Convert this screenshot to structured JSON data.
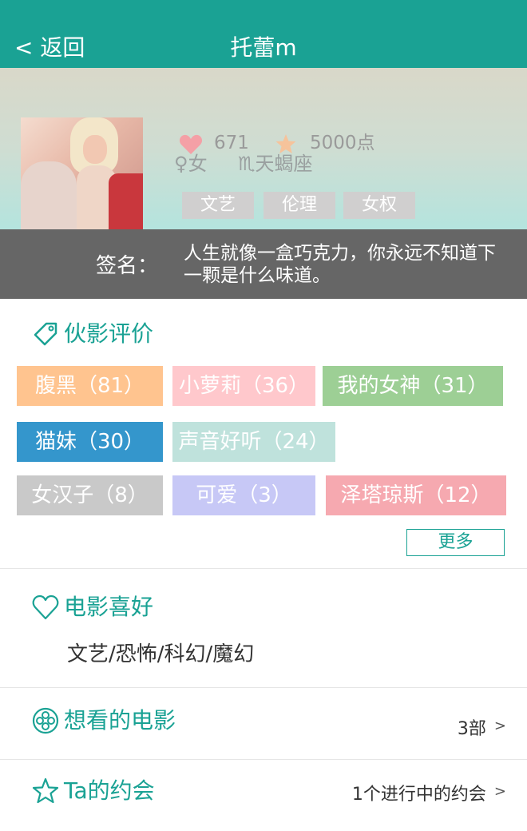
{
  "header": {
    "back_label": "< 返回",
    "title": "托蕾m"
  },
  "profile": {
    "gender": "♀女",
    "zodiac": "♏天蝎座",
    "likes": "671",
    "points": "5000点",
    "tags": [
      "文艺",
      "伦理",
      "女权"
    ]
  },
  "signature": {
    "label": "签名：",
    "text": "人生就像一盒巧克力，你永远不知道下一颗是什么味道。"
  },
  "reviews": {
    "title": "伙影评价",
    "tags": [
      {
        "label": "腹黑（81）",
        "color": "#ffc48f"
      },
      {
        "label": "小萝莉（36）",
        "color": "#ffc8cc"
      },
      {
        "label": "我的女神（31）",
        "color": "#9dcf95"
      },
      {
        "label": "猫妹（30）",
        "color": "#3496cc"
      },
      {
        "label": "声音好听（24）",
        "color": "#bfe2dc"
      },
      {
        "label": "女汉子（8）",
        "color": "#c9c9c9"
      },
      {
        "label": "可爱（3）",
        "color": "#c7c8f6"
      },
      {
        "label": "泽塔琼斯（12）",
        "color": "#f6a9b0"
      }
    ],
    "more_label": "更多"
  },
  "movie_prefs": {
    "title": "电影喜好",
    "value": "文艺/恐怖/科幻/魔幻"
  },
  "want_to_watch": {
    "title": "想看的电影",
    "count": "3部"
  },
  "dates": {
    "title": "Ta的约会",
    "status": "1个进行中的约会"
  },
  "colors": {
    "accent": "#1aa294",
    "signature_bg": "#666666",
    "tag_bg": "#d0cfcf"
  }
}
